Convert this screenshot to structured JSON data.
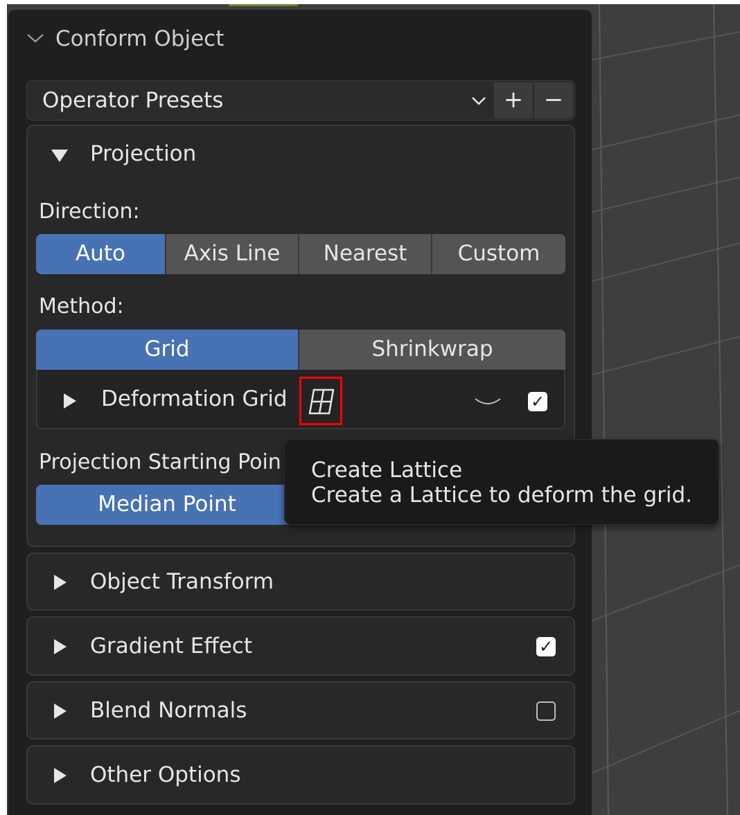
{
  "panel": {
    "title": "Conform Object",
    "presets": {
      "label": "Operator Presets",
      "add": "+",
      "remove": "−"
    }
  },
  "projection": {
    "title": "Projection",
    "direction_label": "Direction:",
    "direction_options": [
      "Auto",
      "Axis Line",
      "Nearest",
      "Custom"
    ],
    "direction_selected": "Auto",
    "method_label": "Method:",
    "method_options": [
      "Grid",
      "Shrinkwrap"
    ],
    "method_selected": "Grid",
    "deformation_grid": {
      "label": "Deformation Grid",
      "enabled": true
    },
    "starting_point_label": "Projection Starting Poin",
    "starting_point_value": "Median Point"
  },
  "tooltip": {
    "title": "Create Lattice",
    "description": "Create a Lattice to deform the grid."
  },
  "sections": [
    {
      "label": "Object Transform"
    },
    {
      "label": "Gradient Effect",
      "checked": true
    },
    {
      "label": "Blend Normals",
      "checked": false
    },
    {
      "label": "Other Options"
    }
  ],
  "colors": {
    "accent": "#4772b3",
    "panel_bg": "#1f1f1f",
    "highlight_box": "#ff0000"
  },
  "icons": {
    "collapse": "chevron-down-icon",
    "expanded": "triangle-down-icon",
    "collapsed": "triangle-right-icon",
    "lattice": "lattice-grid-icon",
    "checkbox": "checkbox-icon"
  }
}
